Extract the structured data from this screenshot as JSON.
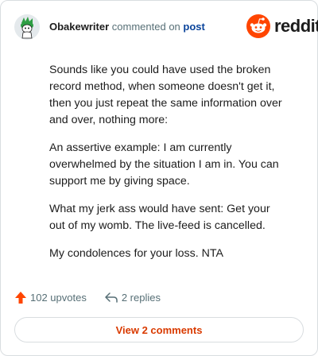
{
  "comment": {
    "username": "Obakewriter",
    "action_text": "commented on",
    "post_link": "post",
    "paragraphs": [
      "Sounds like you could have used the broken record method, when someone doesn't get it, then you just repeat the same information over and over, nothing more:",
      "An assertive example: I am currently overwhelmed by the situation I am in. You can support me by giving space.",
      "What my jerk ass would have sent: Get your out of my womb. The live-feed is cancelled.",
      "My condolences for your loss. NTA"
    ]
  },
  "brand": {
    "name": "reddit",
    "color": "#ff4500"
  },
  "stats": {
    "upvotes_label": "102 upvotes",
    "replies_label": "2 replies"
  },
  "footer": {
    "view_comments_label": "View 2 comments"
  },
  "icons": {
    "avatar": "snoo-avatar-icon",
    "upvote": "upvote-arrow-icon",
    "reply": "reply-arrow-icon",
    "logo": "reddit-snoo-icon"
  },
  "colors": {
    "accent": "#d93a00",
    "upvote": "#ff4500",
    "link": "#0a449b",
    "muted_text": "#576f76"
  }
}
